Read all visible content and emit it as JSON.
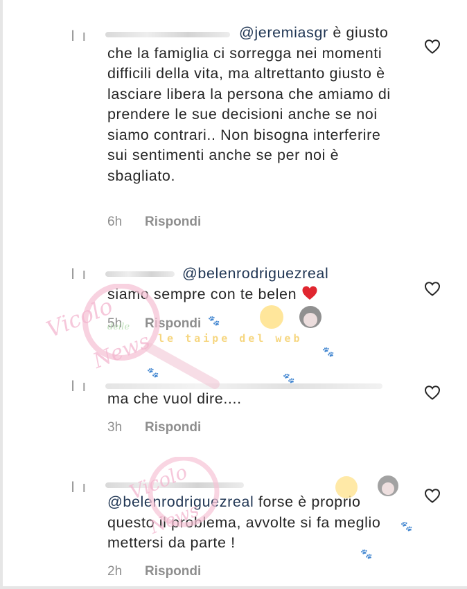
{
  "comments": [
    {
      "mention": "@jeremiasgr",
      "body": " è giusto che la famiglia ci sorregga nei momenti difficili della vita, ma altrettanto giusto è lasciare libera la persona che amiamo di prendere le sue decisioni anche se noi siamo contrari.. Non bisogna interferire sui sentimenti anche se per noi è sbagliato.",
      "time": "6h",
      "reply": "Rispondi"
    },
    {
      "mention": "@belenrodriguezreal",
      "body": "siamo sempre con te belen",
      "time": "5h",
      "reply": "Rispondi"
    },
    {
      "mention": "",
      "body": "ma che vuol dire....",
      "time": "3h",
      "reply": "Rispondi"
    },
    {
      "mention": "@belenrodriguezreal",
      "body": " forse è proprio questo il problema, avvolte si fa meglio mettersi da parte !",
      "time": "2h",
      "reply": "Rispondi"
    }
  ],
  "watermark": {
    "line1": "Vicolo",
    "line2": "delle",
    "line3": "News",
    "banner": "le taipe del web"
  },
  "icons": {
    "like": "heart-outline-icon",
    "emoji": "red-heart-emoji"
  },
  "colors": {
    "text": "#262626",
    "mention": "#1f3553",
    "meta": "#8e8e8e",
    "watermark": "#f3b6cf",
    "emoji_heart": "#e0262f"
  }
}
